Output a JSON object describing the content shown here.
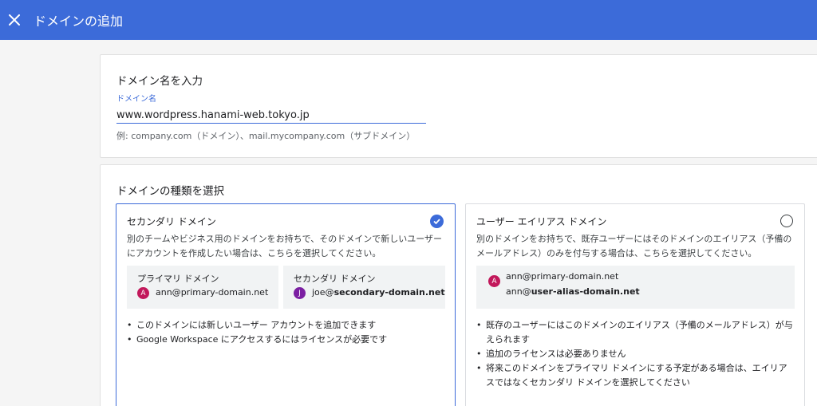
{
  "header": {
    "title": "ドメインの追加"
  },
  "domain_name": {
    "heading": "ドメイン名を入力",
    "label": "ドメイン名",
    "value": "www.wordpress.hanami-web.tokyo.jp",
    "hint": "例: company.com（ドメイン）、mail.mycompany.com（サブドメイン）"
  },
  "domain_type": {
    "heading": "ドメインの種類を選択",
    "secondary": {
      "title": "セカンダリ ドメイン",
      "selected": true,
      "desc": "別のチームやビジネス用のドメインをお持ちで、そのドメインで新しいユーザーにアカウントを作成したい場合は、こちらを選択してください。",
      "primary_box": {
        "title": "プライマリ ドメイン",
        "avatar": "A",
        "email_user": "ann@",
        "email_domain": "primary-domain.net"
      },
      "secondary_box": {
        "title": "セカンダリ ドメイン",
        "avatar": "J",
        "email_user": "joe@",
        "email_domain": "secondary-domain.net"
      },
      "bullets": [
        "このドメインには新しいユーザー アカウントを追加できます",
        "Google Workspace にアクセスするにはライセンスが必要です"
      ]
    },
    "alias": {
      "title": "ユーザー エイリアス ドメイン",
      "selected": false,
      "desc": "別のドメインをお持ちで、既存ユーザーにはそのドメインのエイリアス（予備のメールアドレス）のみを付与する場合は、こちらを選択してください。",
      "box": {
        "avatar": "A",
        "email1": "ann@primary-domain.net",
        "email2_user": "ann@",
        "email2_domain": "user-alias-domain.net"
      },
      "bullets": [
        "既存のユーザーにはこのドメインのエイリアス（予備のメールアドレス）が与えられます",
        "追加のライセンスは必要ありません",
        "将来このドメインをプライマリ ドメインにする予定がある場合は、エイリアスではなくセカンダリ ドメインを選択してください"
      ]
    }
  },
  "colors": {
    "brand": "#3c6bd9",
    "avatar_a": "#c2185b",
    "avatar_j": "#7b1fa2"
  }
}
